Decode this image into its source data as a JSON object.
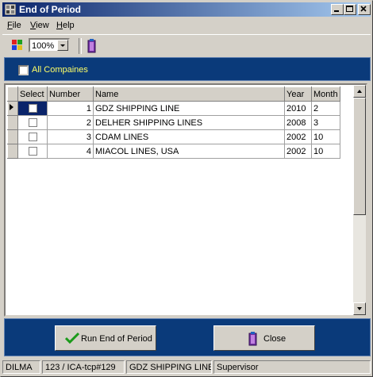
{
  "window": {
    "title": "End of Period"
  },
  "menu": [
    {
      "label": "File",
      "key": "F",
      "rest": "ile"
    },
    {
      "label": "View",
      "key": "V",
      "rest": "iew"
    },
    {
      "label": "Help",
      "key": "H",
      "rest": "elp"
    }
  ],
  "toolbar": {
    "zoom_value": "100%"
  },
  "filter": {
    "all_companies_label": "All Compaines",
    "all_companies_checked": false
  },
  "grid": {
    "columns": [
      "Select",
      "Number",
      "Name",
      "Year",
      "Month"
    ],
    "rows": [
      {
        "number": "1",
        "name": "GDZ SHIPPING LINE",
        "year": "2010",
        "month": "2",
        "selected": false,
        "current": true
      },
      {
        "number": "2",
        "name": "DELHER SHIPPING LINES",
        "year": "2008",
        "month": "3",
        "selected": false,
        "current": false
      },
      {
        "number": "3",
        "name": "CDAM LINES",
        "year": "2002",
        "month": "10",
        "selected": false,
        "current": false
      },
      {
        "number": "4",
        "name": "MIACOL LINES, USA",
        "year": "2002",
        "month": "10",
        "selected": false,
        "current": false
      }
    ]
  },
  "buttons": {
    "run_label": "Run End of Period",
    "close_label": "Close"
  },
  "status": {
    "user": "DILMA",
    "terminal": "123 / ICA-tcp#129",
    "company": "GDZ SHIPPING LINE",
    "role": "Supervisor"
  },
  "colors": {
    "panel_blue": "#0a3a7a",
    "title_start": "#0a246a",
    "label_yellow": "#ffff66"
  }
}
